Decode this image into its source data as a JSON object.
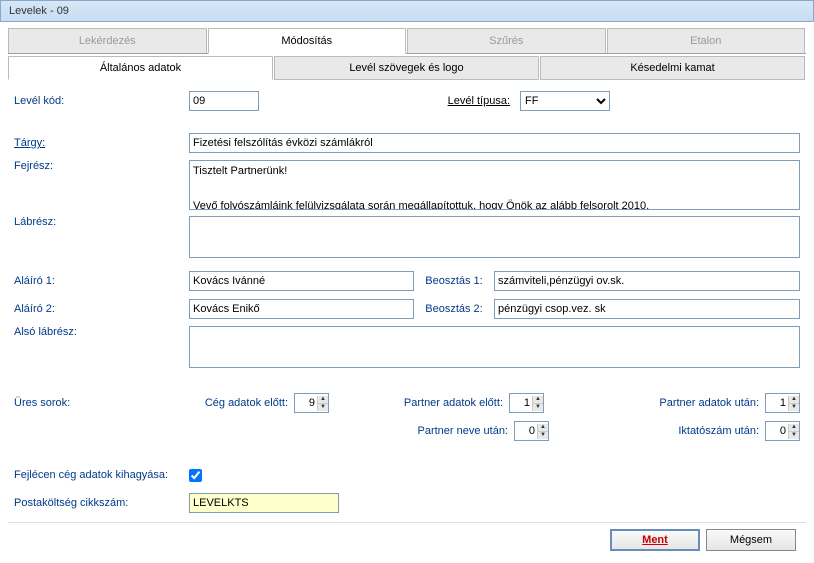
{
  "window": {
    "title": "Levelek - 09"
  },
  "mainTabs": {
    "t0": "Lekérdezés",
    "t1": "Módosítás",
    "t2": "Szűrés",
    "t3": "Etalon"
  },
  "subTabs": {
    "s0": "Általános adatok",
    "s1": "Levél szövegek és logo",
    "s2": "Késedelmi kamat"
  },
  "labels": {
    "levelKod": "Levél kód:",
    "levelTipusa": "Levél típusa:",
    "targy": "Tárgy:",
    "fejresz": "Fejrész:",
    "labresz": "Lábrész:",
    "alairo1": "Aláíró 1:",
    "alairo2": "Aláíró 2:",
    "beosztas1": "Beosztás 1:",
    "beosztas2": "Beosztás 2:",
    "alsoLabresz": "Alsó lábrész:",
    "uresSorok": "Üres sorok:",
    "cegAdatokElott": "Cég adatok előtt:",
    "partnerAdatokElott": "Partner adatok előtt:",
    "partnerAdatokUtan": "Partner adatok után:",
    "partnerNeveUtan": "Partner neve után:",
    "iktatoszamUtan": "Iktatószám után:",
    "fejlecenCeg": "Fejlécen cég adatok kihagyása:",
    "postakoltseg": "Postaköltség cikkszám:"
  },
  "values": {
    "levelKod": "09",
    "levelTipusa": "FF",
    "targy": "Fizetési felszólítás évközi számlákról",
    "fejresz": "Tisztelt Partnerünk!\n\nVevő folyószámláink felülvizsgálata során megállapítottuk, hogy Önök az alább felsorolt 2010.",
    "labresz": "",
    "alairo1": "Kovács Ivánné",
    "alairo2": "Kovács Enikő",
    "beosztas1": "számviteli,pénzügyi ov.sk.",
    "beosztas2": "pénzügyi csop.vez. sk",
    "alsoLabresz": "",
    "cegAdatokElott": "9",
    "partnerAdatokElott": "1",
    "partnerAdatokUtan": "1",
    "partnerNeveUtan": "0",
    "iktatoszamUtan": "0",
    "fejlecenCeg": true,
    "postakoltseg": "LEVELKTS"
  },
  "buttons": {
    "save": "Ment",
    "cancel": "Mégsem"
  }
}
